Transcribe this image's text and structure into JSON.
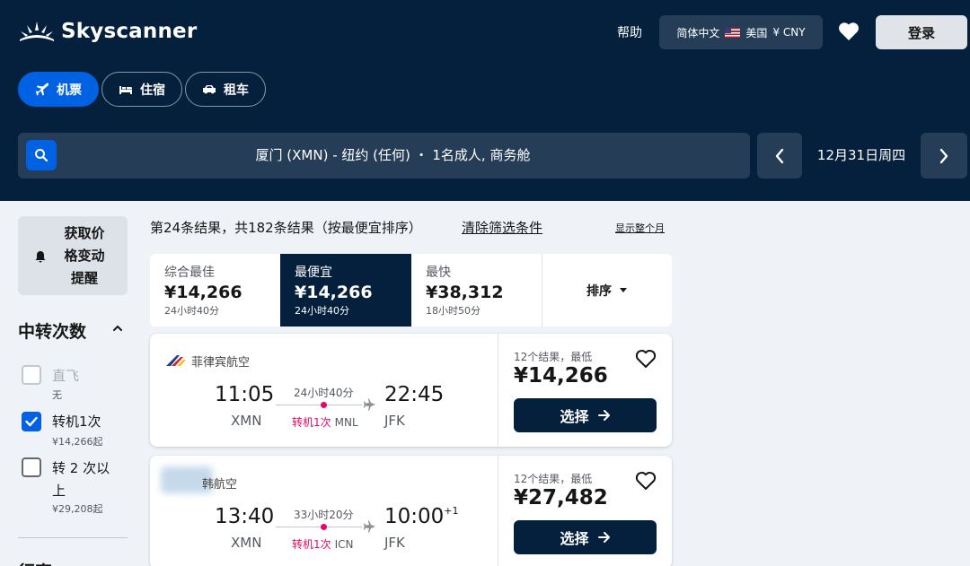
{
  "brand": {
    "name": "Skyscanner"
  },
  "nav": {
    "help": "帮助",
    "locale": {
      "language": "简体中文",
      "country": "美国",
      "currency": "¥ CNY"
    },
    "login": "登录"
  },
  "verticals": [
    {
      "label": "机票",
      "icon": "plane-icon",
      "active": true
    },
    {
      "label": "住宿",
      "icon": "bed-icon",
      "active": false
    },
    {
      "label": "租车",
      "icon": "car-icon",
      "active": false
    }
  ],
  "search": {
    "summary": "厦门 (XMN) - 纽约 (任何) ・ 1名成人, 商务舱",
    "date": "12月31日周四"
  },
  "sidebar": {
    "price_alert": "获取价格变动提醒",
    "price_alert_lines": [
      "获取价",
      "格变动",
      "提醒"
    ],
    "stops_title": "中转次数",
    "stops": [
      {
        "label": "直飞",
        "sub": "无",
        "checked": false,
        "disabled": true
      },
      {
        "label": "转机1次",
        "sub": "¥14,266起",
        "checked": true,
        "disabled": false
      },
      {
        "label_lines": [
          "转 2 次以",
          "上"
        ],
        "sub": "¥29,208起",
        "checked": false,
        "disabled": false
      }
    ],
    "next_section": "行直"
  },
  "results": {
    "info": "第24条结果，共182条结果（按最便宜排序）",
    "clear_filters": "清除筛选条件",
    "whole_month": "显示整个月"
  },
  "sort_tabs": [
    {
      "label": "综合最佳",
      "price": "¥14,266",
      "duration": "24小时40分",
      "active": false
    },
    {
      "label": "最便宜",
      "price": "¥14,266",
      "duration": "24小时40分",
      "active": true
    },
    {
      "label": "最快",
      "price": "¥38,312",
      "duration": "18小时50分",
      "active": false
    }
  ],
  "sort_button": "排序",
  "flights": [
    {
      "airline": "菲律宾航空",
      "dep_time": "11:05",
      "dep_code": "XMN",
      "arr_time": "22:45",
      "arr_code": "JFK",
      "day_offset": "",
      "duration": "24小时40分",
      "stops": "转机1次",
      "stop_code": "MNL",
      "price_note": "12个结果，最低",
      "price": "¥14,266",
      "select": "选择"
    },
    {
      "airline": "韩航空",
      "dep_time": "13:40",
      "dep_code": "XMN",
      "arr_time": "10:00",
      "arr_code": "JFK",
      "day_offset": "+1",
      "duration": "33小时20分",
      "stops": "转机1次",
      "stop_code": "ICN",
      "price_note": "12个结果，最低",
      "price": "¥27,482",
      "select": "选择"
    }
  ],
  "colors": {
    "header_bg": "#05203c",
    "accent": "#0062e3",
    "stop_red": "#e70866"
  }
}
